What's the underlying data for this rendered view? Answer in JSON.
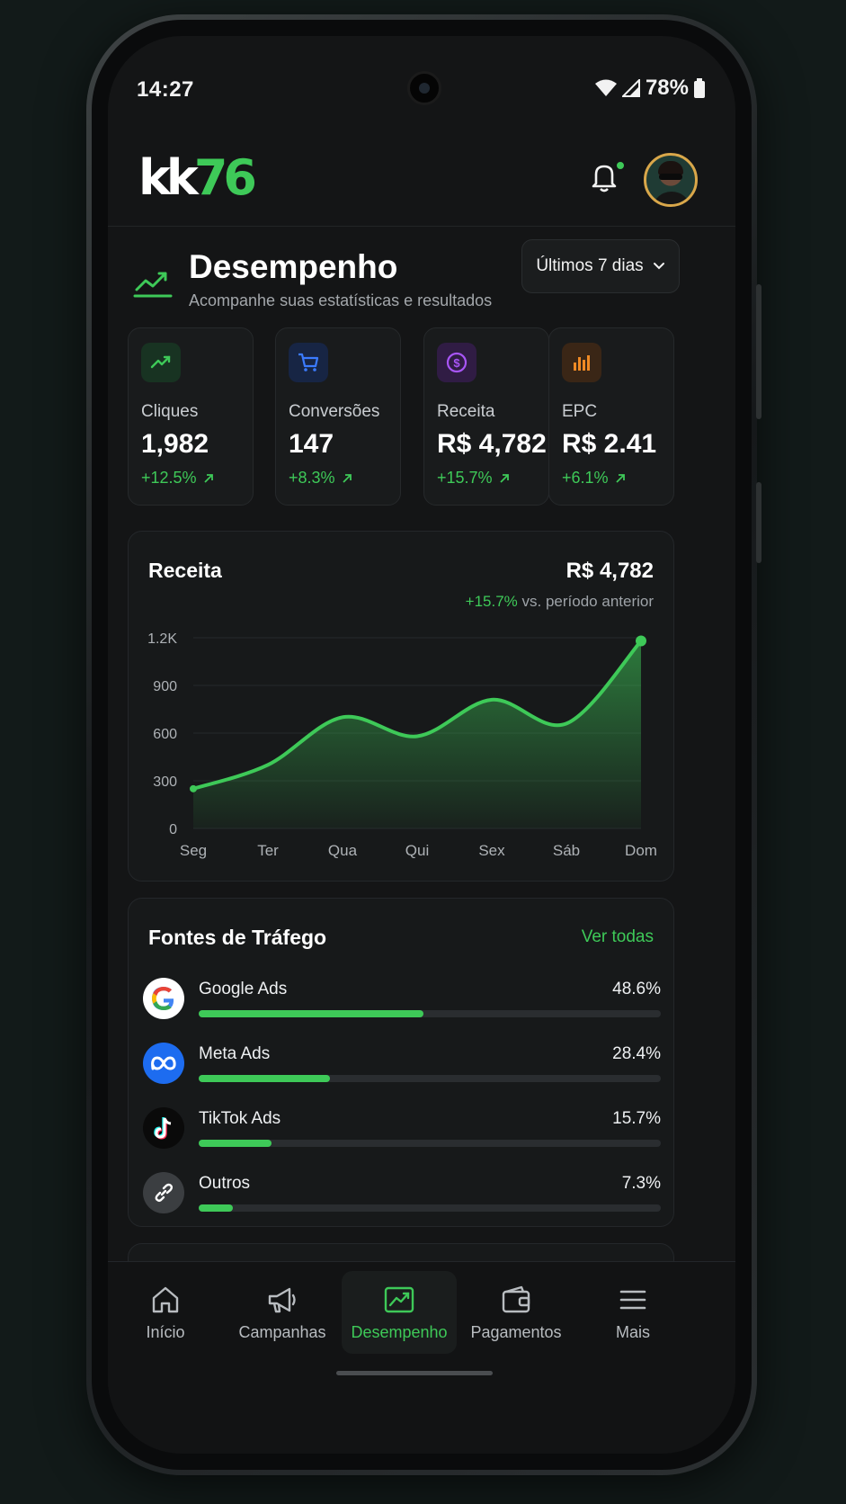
{
  "status_bar": {
    "time": "14:27",
    "battery": "78%"
  },
  "header": {
    "logo_prefix": "kk",
    "logo_suffix": "76",
    "colors": {
      "accent": "#3ec958",
      "background": "#141516"
    }
  },
  "page": {
    "title": "Desempenho",
    "subtitle": "Acompanhe suas estatísticas e resultados",
    "period_selector": "Últimos 7 dias"
  },
  "stats": [
    {
      "label": "Cliques",
      "value": "1,982",
      "change": "+12.5%",
      "icon": "trending-up-icon",
      "color": "#3ec958"
    },
    {
      "label": "Conversões",
      "value": "147",
      "change": "+8.3%",
      "icon": "cart-icon",
      "color": "#3b7bff"
    },
    {
      "label": "Receita",
      "value": "R$ 4,782",
      "change": "+15.7%",
      "icon": "dollar-circle-icon",
      "color": "#a855f7"
    },
    {
      "label": "EPC",
      "value": "R$ 2.41",
      "change": "+6.1%",
      "icon": "bar-chart-icon",
      "color": "#f08a24"
    }
  ],
  "revenue": {
    "title": "Receita",
    "total": "R$ 4,782",
    "change": "+15.7%",
    "comparison": "vs. período anterior"
  },
  "chart_data": {
    "type": "area",
    "categories": [
      "Seg",
      "Ter",
      "Qua",
      "Qui",
      "Sex",
      "Sáb",
      "Dom"
    ],
    "values": [
      250,
      400,
      700,
      580,
      810,
      660,
      1180
    ],
    "yticks": [
      "1.2K",
      "900",
      "600",
      "300",
      "0"
    ],
    "ylim": [
      0,
      1200
    ],
    "grid": true,
    "color": "#3ec958"
  },
  "traffic": {
    "title": "Fontes de Tráfego",
    "see_all": "Ver todas",
    "sources": [
      {
        "name": "Google Ads",
        "percent": "48.6%",
        "share": 0.486,
        "icon": "google-icon"
      },
      {
        "name": "Meta Ads",
        "percent": "28.4%",
        "share": 0.284,
        "icon": "meta-icon"
      },
      {
        "name": "TikTok Ads",
        "percent": "15.7%",
        "share": 0.157,
        "icon": "tiktok-icon"
      },
      {
        "name": "Outros",
        "percent": "7.3%",
        "share": 0.073,
        "icon": "link-icon"
      }
    ]
  },
  "nav": [
    {
      "label": "Início",
      "icon": "home-icon"
    },
    {
      "label": "Campanhas",
      "icon": "megaphone-icon"
    },
    {
      "label": "Desempenho",
      "icon": "trending-chart-icon",
      "active": true
    },
    {
      "label": "Pagamentos",
      "icon": "wallet-icon"
    },
    {
      "label": "Mais",
      "icon": "menu-icon"
    }
  ]
}
